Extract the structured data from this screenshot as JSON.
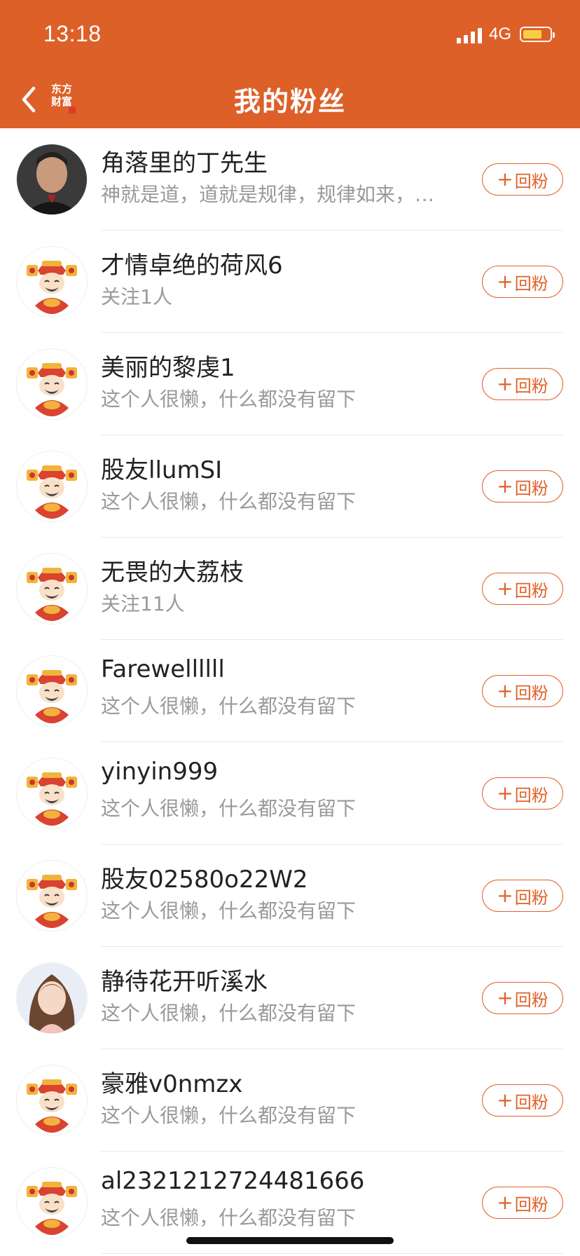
{
  "status_bar": {
    "time": "13:18",
    "network": "4G",
    "battery_icon": "battery-icon",
    "signal_icon": "signal-icon"
  },
  "nav": {
    "title": "我的粉丝",
    "back_icon": "chevron-left-icon",
    "logo_text": "东方财富"
  },
  "colors": {
    "header_bg": "#DD6029",
    "accent": "#E0622A",
    "text": "#222222",
    "subtext": "#9A9A9A"
  },
  "follow_label": "回粉",
  "fans": [
    {
      "name": "角落里的丁先生",
      "desc": "神就是道，道就是规律，规律如来，…",
      "avatar": "photo-man"
    },
    {
      "name": "才情卓绝的荷风6",
      "desc": "关注1人",
      "avatar": "caishen"
    },
    {
      "name": "美丽的黎虔1",
      "desc": "这个人很懒，什么都没有留下",
      "avatar": "caishen"
    },
    {
      "name": "股友llumSI",
      "desc": "这个人很懒，什么都没有留下",
      "avatar": "caishen"
    },
    {
      "name": "无畏的大荔枝",
      "desc": "关注11人",
      "avatar": "caishen"
    },
    {
      "name": "Farewellllll",
      "desc": "这个人很懒，什么都没有留下",
      "avatar": "caishen"
    },
    {
      "name": "yinyin999",
      "desc": "这个人很懒，什么都没有留下",
      "avatar": "caishen"
    },
    {
      "name": "股友02580o22W2",
      "desc": "这个人很懒，什么都没有留下",
      "avatar": "caishen"
    },
    {
      "name": "静待花开听溪水",
      "desc": "这个人很懒，什么都没有留下",
      "avatar": "photo-woman"
    },
    {
      "name": "豪雅v0nmzx",
      "desc": "这个人很懒，什么都没有留下",
      "avatar": "caishen"
    },
    {
      "name": "al2321212724481666",
      "desc": "这个人很懒，什么都没有留下",
      "avatar": "caishen"
    }
  ]
}
